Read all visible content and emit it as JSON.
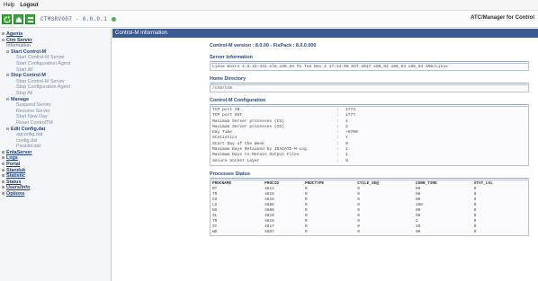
{
  "menu": {
    "help": "Help",
    "logout": "Logout"
  },
  "toolbar": {
    "server": "CTMSRV007 - 8.0.0.1",
    "brand": "ATC/Manager for Control"
  },
  "sidebar": {
    "items": [
      {
        "label": "Agents",
        "level": 0,
        "exp": "⊞"
      },
      {
        "label": "Ctm Server",
        "level": 0,
        "exp": "⊟"
      },
      {
        "label": "Information",
        "level": 1,
        "exp": "",
        "leaf": true
      },
      {
        "label": "Start Control-M",
        "level": 1,
        "exp": "⊟"
      },
      {
        "label": "Start Control-M Server",
        "level": 2
      },
      {
        "label": "Start Configuration Agent",
        "level": 2
      },
      {
        "label": "Start All",
        "level": 2
      },
      {
        "label": "Stop Control-M",
        "level": 1,
        "exp": "⊟"
      },
      {
        "label": "Stop Control-M Server",
        "level": 2
      },
      {
        "label": "Stop Configuration Agent",
        "level": 2
      },
      {
        "label": "Stop All",
        "level": 2
      },
      {
        "label": "Manage",
        "level": 1,
        "exp": "⊟"
      },
      {
        "label": "Suspend Server",
        "level": 2
      },
      {
        "label": "Resume Server",
        "level": 2
      },
      {
        "label": "Start New Day",
        "level": 2
      },
      {
        "label": "Reset ControlTM",
        "level": 2
      },
      {
        "label": "Edit Config.dat",
        "level": 1,
        "exp": "⊟",
        "sub": true
      },
      {
        "label": "agconfig.dat",
        "level": 2
      },
      {
        "label": "config.dat",
        "level": 2
      },
      {
        "label": "Parallel.dat",
        "level": 2
      },
      {
        "label": "EntaServer",
        "level": 0,
        "exp": "⊞"
      },
      {
        "label": "Logs",
        "level": 0,
        "exp": "⊞"
      },
      {
        "label": "Portal",
        "level": 0,
        "exp": "⊞"
      },
      {
        "label": "Standuk",
        "level": 0,
        "exp": "⊞"
      },
      {
        "label": "Statistic",
        "level": 0,
        "exp": "⊞"
      },
      {
        "label": "Status",
        "level": 0,
        "exp": "⊞"
      },
      {
        "label": "Users/Info",
        "level": 0,
        "exp": "⊞"
      },
      {
        "label": "Options",
        "level": 0,
        "exp": "⊞"
      }
    ]
  },
  "main": {
    "header": "Control-M Information",
    "version": "Control-M version : 8.0.00 - FixPack : 8.0.0.000",
    "server_info_title": "Server Information",
    "server_info": "Linux mnsrv 2.6.32-431.el6.x86_64 #1 Tue Nov 3 17:14:08 EST 2017 x86_64 x86_64 x86_64 GNU/Linux",
    "home_title": "Home Directory",
    "home": "/ctm/ctm",
    "config_title": "Control-M Configuration",
    "config": [
      {
        "k": "TCP port IN",
        "v": "1774"
      },
      {
        "k": "TCP port OUT",
        "v": "1777"
      },
      {
        "k": "Maximum Server processes (CS)",
        "v": "4"
      },
      {
        "k": "Maximum Server processes (CD)",
        "v": "2"
      },
      {
        "k": "Day Time",
        "v": "+0700"
      },
      {
        "k": "Statistics",
        "v": "Y"
      },
      {
        "k": "Start Day of the Week",
        "v": "0"
      },
      {
        "k": "Maximum Days Retained by IOAGATE-M Log",
        "v": "1"
      },
      {
        "k": "Maximum Days to Retain Output Files",
        "v": "1"
      },
      {
        "k": "Secure Socket Layer",
        "v": "N"
      }
    ],
    "proc_title": "Processes Status",
    "proc_headers": [
      "PROCNAME",
      "PROCID",
      "PROCTYPE",
      "CYCLE_SEQ",
      "CURR_TIME",
      "STAT_LVL"
    ],
    "proc_rows": [
      [
        "RT",
        "4814",
        "R",
        "0",
        "00",
        "0"
      ],
      [
        "TR",
        "4815",
        "R",
        "0",
        "00",
        "0"
      ],
      [
        "CS",
        "4816",
        "R",
        "0",
        "00",
        "0"
      ],
      [
        "LG",
        "4808",
        "R",
        "0",
        "100",
        "0"
      ],
      [
        "NS",
        "4806",
        "R",
        "0",
        "00",
        "0"
      ],
      [
        "SL",
        "4810",
        "R",
        "0",
        "00",
        "0"
      ],
      [
        "TR",
        "4818",
        "R",
        "0",
        "2",
        "0"
      ],
      [
        "ST",
        "4817",
        "R",
        "0",
        "10",
        "0"
      ],
      [
        "WD",
        "4807",
        "R",
        "0",
        "00",
        "0"
      ]
    ]
  }
}
